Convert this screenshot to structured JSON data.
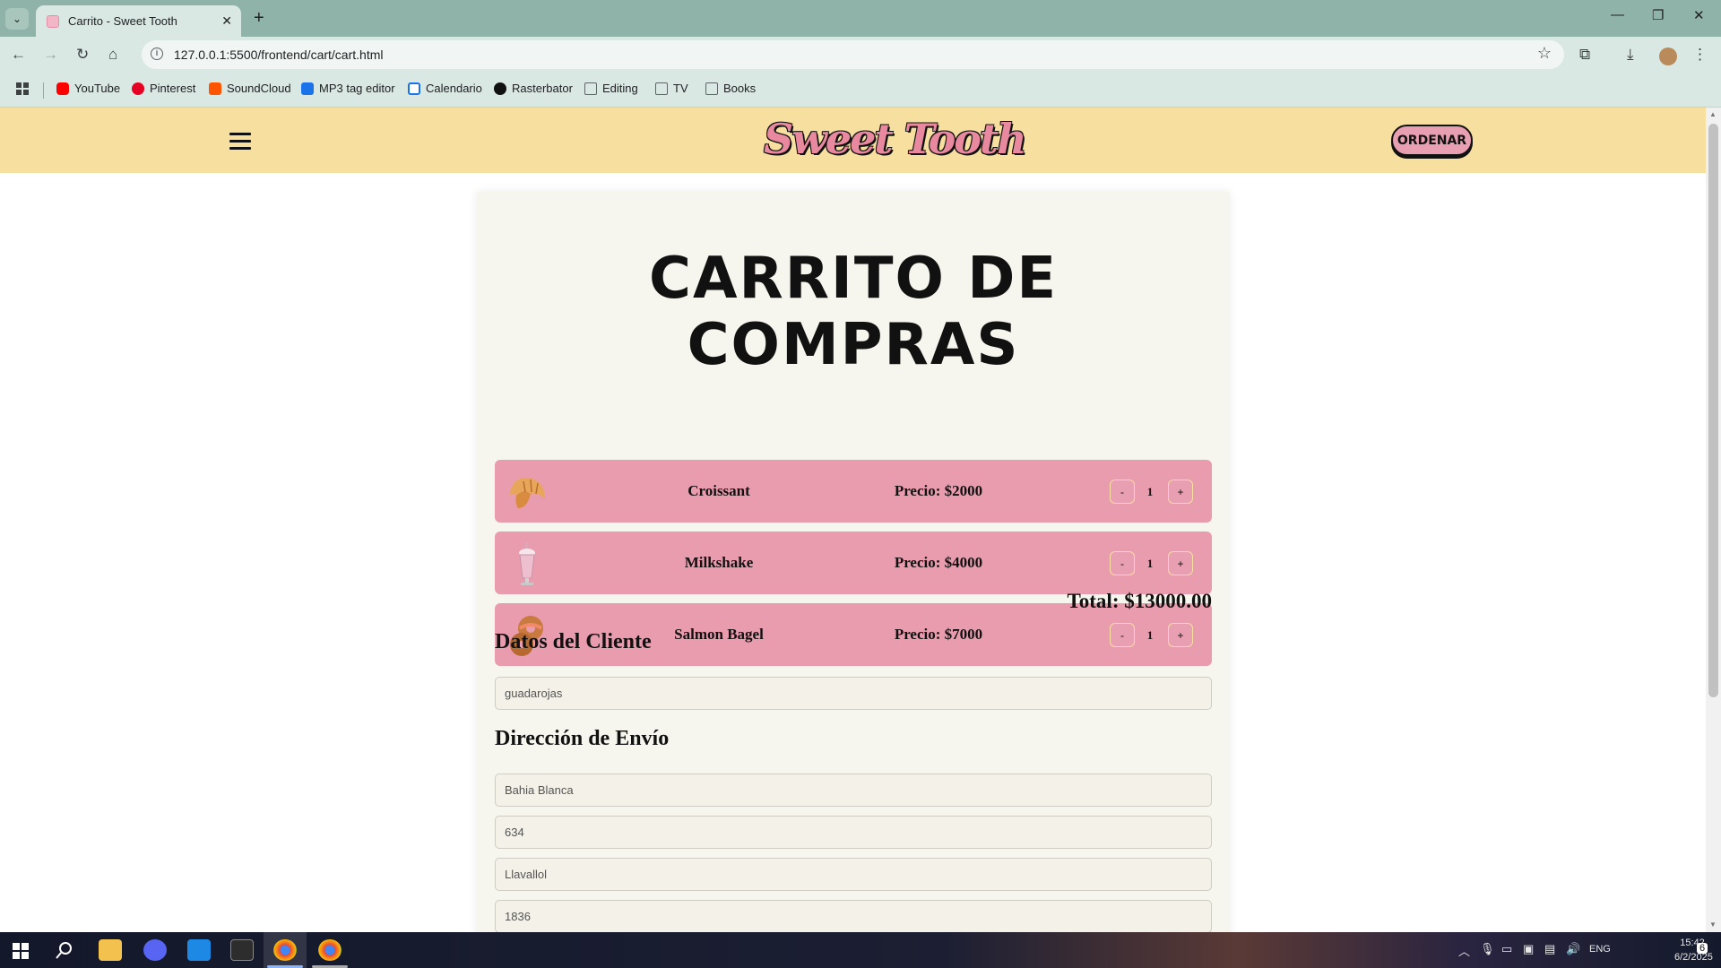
{
  "browser": {
    "tab_title": "Carrito - Sweet Tooth",
    "url": "127.0.0.1:5500/frontend/cart/cart.html",
    "bookmarks": [
      {
        "label": "YouTube",
        "icon": "youtube-icon",
        "color": "#ff0000"
      },
      {
        "label": "Pinterest",
        "icon": "pinterest-icon",
        "color": "#e60023"
      },
      {
        "label": "SoundCloud",
        "icon": "soundcloud-icon",
        "color": "#ff5500"
      },
      {
        "label": "MP3 tag editor",
        "icon": "tag-icon",
        "color": "#1a73e8"
      },
      {
        "label": "Calendario",
        "icon": "calendar-icon",
        "color": "#1a73e8"
      },
      {
        "label": "Rasterbator",
        "icon": "circle-icon",
        "color": "#111111"
      },
      {
        "label": "Editing",
        "icon": "folder-icon",
        "color": "#5f6368"
      },
      {
        "label": "TV",
        "icon": "folder-icon",
        "color": "#5f6368"
      },
      {
        "label": "Books",
        "icon": "folder-icon",
        "color": "#5f6368"
      }
    ]
  },
  "header": {
    "logo": "Sweet Tooth",
    "order_button": "ORDENAR",
    "colors": {
      "header_bg": "#f7dfa0",
      "accent_pink": "#e79fb1"
    }
  },
  "cart": {
    "title": "CARRITO DE COMPRAS",
    "items": [
      {
        "name": "Croissant",
        "price": "Precio: $2000",
        "qty": "1",
        "icon": "croissant-icon"
      },
      {
        "name": "Milkshake",
        "price": "Precio: $4000",
        "qty": "1",
        "icon": "milkshake-icon"
      },
      {
        "name": "Salmon Bagel",
        "price": "Precio: $7000",
        "qty": "1",
        "icon": "bagel-icon"
      }
    ],
    "minus_label": "-",
    "plus_label": "+",
    "total": "Total: $13000.00"
  },
  "client": {
    "heading": "Datos del Cliente",
    "name_value": "guadarojas"
  },
  "shipping": {
    "heading": "Dirección de Envío",
    "fields": [
      "Bahia Blanca",
      "634",
      "Llavallol",
      "1836"
    ]
  },
  "taskbar": {
    "language": "ENG",
    "time": "15:42",
    "date": "6/2/2025",
    "notifications": "6"
  }
}
